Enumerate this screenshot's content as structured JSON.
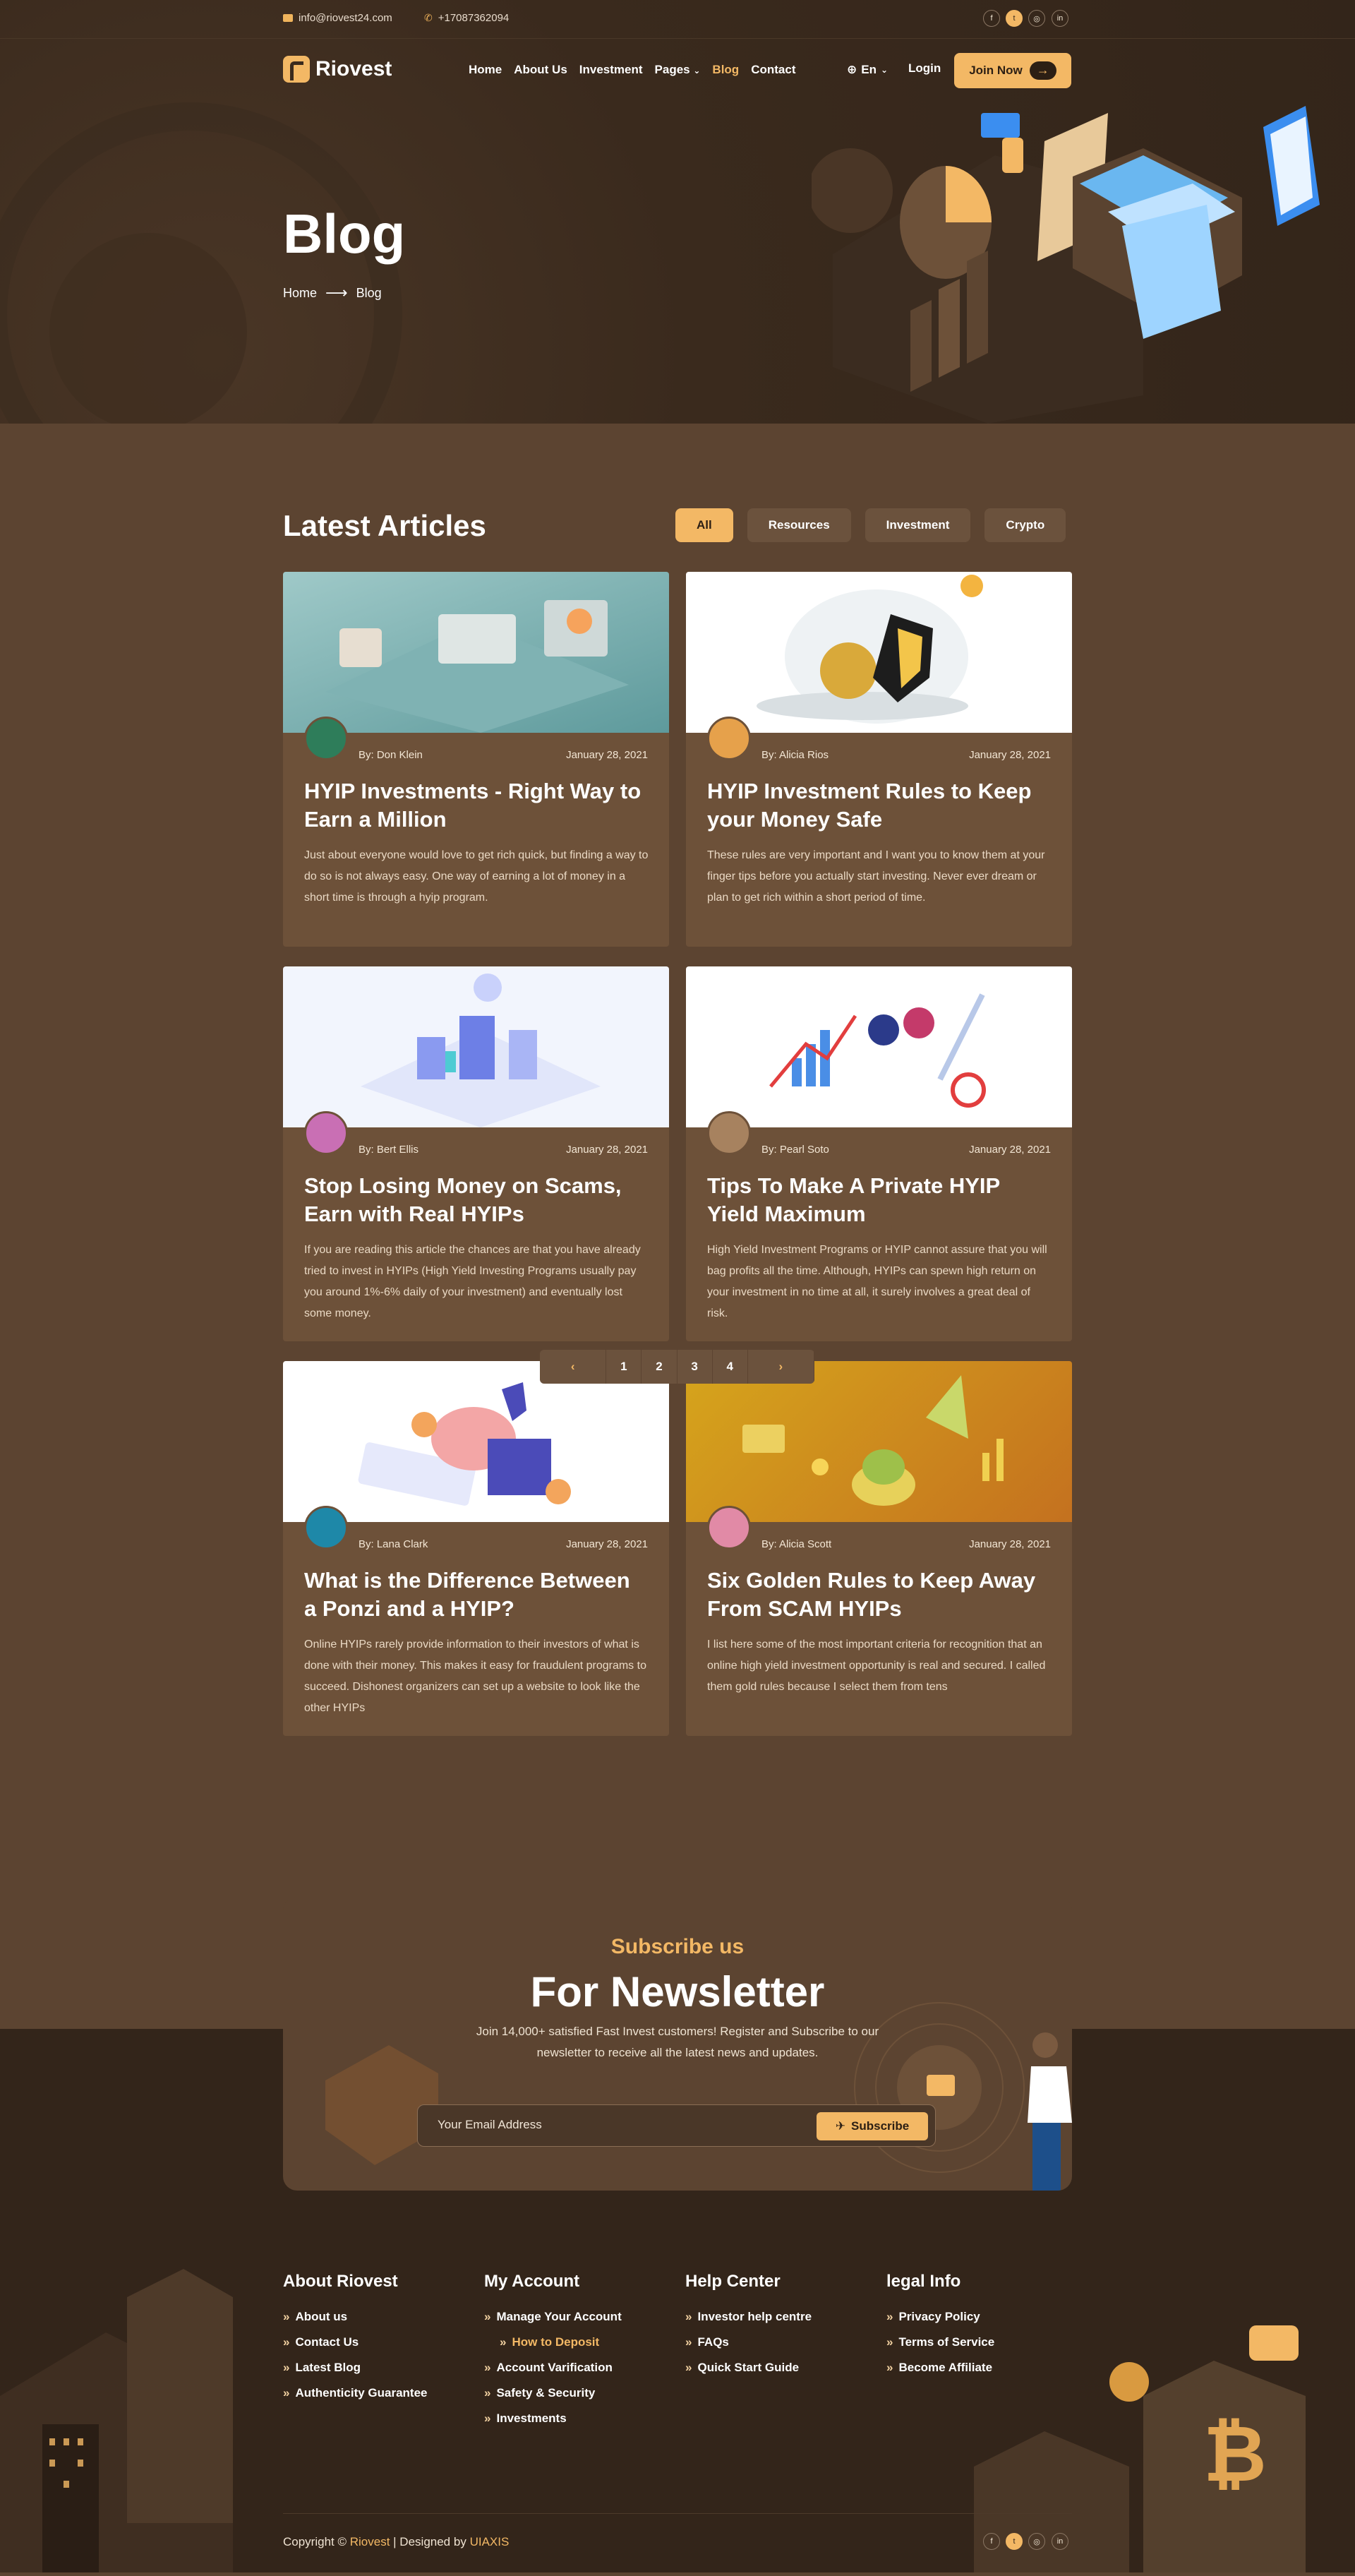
{
  "topbar": {
    "email": "info@riovest24.com",
    "phone": "+17087362094",
    "social": [
      "f",
      "t",
      "ig",
      "in"
    ]
  },
  "nav": {
    "logo": "Riovest",
    "items": [
      "Home",
      "About Us",
      "Investment",
      "Pages",
      "Blog",
      "Contact"
    ],
    "active": "Blog",
    "lang": "En",
    "login": "Login",
    "join": "Join Now"
  },
  "hero": {
    "title": "Blog",
    "crumb_home": "Home",
    "crumb_current": "Blog"
  },
  "articles": {
    "title": "Latest Articles",
    "filters": [
      "All",
      "Resources",
      "Investment",
      "Crypto"
    ],
    "cards": [
      {
        "author": "By: Don Klein",
        "date": "January 28, 2021",
        "title": "HYIP Investments - Right Way to Earn a Million",
        "text": "Just about everyone would love to get rich quick, but finding a way to do so is not always easy. One way of earning a lot of money in a short time is through a hyip program."
      },
      {
        "author": "By: Alicia Rios",
        "date": "January 28, 2021",
        "title": "HYIP Investment Rules to Keep your Money Safe",
        "text": "These rules are very important and I want you to know them at your finger tips before you actually start investing. Never ever dream or plan to get rich within a short period of time."
      },
      {
        "author": "By: Bert Ellis",
        "date": "January 28, 2021",
        "title": "Stop Losing Money on Scams, Earn with Real HYIPs",
        "text": "If you are reading this article the chances are that you have already tried to invest in HYIPs (High Yield Investing Programs usually pay you around 1%-6% daily of your investment) and eventually lost some money."
      },
      {
        "author": "By: Pearl Soto",
        "date": "January 28, 2021",
        "title": "Tips To Make A Private HYIP Yield Maximum",
        "text": "High Yield Investment Programs or HYIP cannot assure that you will bag profits all the time. Although, HYIPs can spewn high return on your investment in no time at all, it surely involves a great deal of risk."
      },
      {
        "author": "By: Lana Clark",
        "date": "January 28, 2021",
        "title": "What is the Difference Between a Ponzi and a HYIP?",
        "text": "Online HYIPs rarely provide information to their investors of what is done with their money. This makes it easy for fraudulent programs to succeed. Dishonest organizers can set up a website to look like the other HYIPs"
      },
      {
        "author": "By: Alicia Scott",
        "date": "January 28, 2021",
        "title": "Six Golden Rules to Keep Away From SCAM HYIPs",
        "text": "I list here some of the most important criteria for recognition that an online high yield investment opportunity is real and secured. I called them gold rules because I select them from tens"
      }
    ],
    "pages": [
      "‹",
      "1",
      "2",
      "3",
      "4",
      "›"
    ]
  },
  "newsletter": {
    "sub": "Subscribe us",
    "title": "For Newsletter",
    "text": "Join 14,000+ satisfied Fast Invest customers! Register and Subscribe to our newsletter to receive all the latest news and updates.",
    "placeholder": "Your Email Address",
    "button": "Subscribe"
  },
  "footer": {
    "cols": [
      {
        "title": "About Riovest",
        "items": [
          "About us",
          "Contact Us",
          "Latest Blog",
          "Authenticity Guarantee"
        ]
      },
      {
        "title": "My Account",
        "items": [
          "Manage Your Account",
          "How to Deposit",
          "Account Varification",
          "Safety & Security",
          "Investments"
        ]
      },
      {
        "title": "Help Center",
        "items": [
          "Investor help centre",
          "FAQs",
          "Quick Start Guide"
        ]
      },
      {
        "title": "legal Info",
        "items": [
          "Privacy Policy",
          "Terms of Service",
          "Become Affiliate"
        ]
      }
    ],
    "copy_pre": "Copyright ©",
    "copy_brand": "Riovest",
    "copy_mid": "| Designed by",
    "copy_designer": "UIAXIS"
  },
  "colors": {
    "accent": "#f3b865",
    "bg": "#5c4431",
    "dark": "#33251a"
  }
}
